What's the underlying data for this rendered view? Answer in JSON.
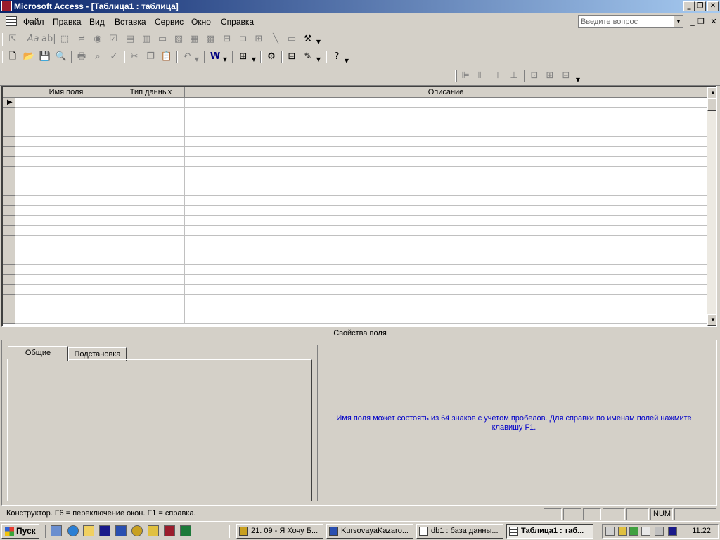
{
  "window": {
    "title": "Microsoft Access - [Таблица1 : таблица]",
    "controls": {
      "minimize": "_",
      "restore": "❐",
      "close": "✕"
    }
  },
  "menu": {
    "items": [
      {
        "label": "Файл"
      },
      {
        "label": "Правка"
      },
      {
        "label": "Вид"
      },
      {
        "label": "Вставка"
      },
      {
        "label": "Сервис"
      },
      {
        "label": "Окно"
      },
      {
        "label": "Справка"
      }
    ],
    "help_placeholder": "Введите вопрос",
    "mdi_controls": {
      "minimize": "_",
      "restore": "❐",
      "close": "✕"
    }
  },
  "toolbox": {
    "icons": [
      "pointer-icon",
      "label-aa-icon",
      "textbox-ab-icon",
      "option-group-icon",
      "toggle-button-icon",
      "option-button-icon",
      "checkbox-icon",
      "combo-box-icon",
      "list-box-icon",
      "command-button-icon",
      "image-icon",
      "unbound-frame-icon",
      "bound-frame-icon",
      "page-break-icon",
      "tab-control-icon",
      "subform-icon",
      "line-icon",
      "rectangle-icon",
      "more-controls-icon"
    ]
  },
  "design_toolbar": {
    "icons": [
      "view-icon",
      "new-icon",
      "open-icon",
      "save-icon",
      "search-icon",
      "print-icon",
      "print-preview-icon",
      "spelling-icon",
      "cut-icon",
      "copy-icon",
      "paste-icon",
      "undo-icon",
      "primary-key-icon",
      "indexes-icon",
      "insert-rows-icon",
      "delete-rows-icon",
      "properties-icon",
      "build-icon",
      "database-window-icon",
      "new-object-icon",
      "help-icon"
    ]
  },
  "align_toolbar": {
    "icons": [
      "align-left-icon",
      "align-right-icon",
      "align-top-icon",
      "align-bottom-icon",
      "size-to-fit-icon",
      "size-to-grid-icon",
      "spacing-icon"
    ]
  },
  "grid": {
    "columns": [
      {
        "label": "Имя поля"
      },
      {
        "label": "Тип данных"
      },
      {
        "label": "Описание"
      }
    ]
  },
  "properties": {
    "title": "Свойства поля",
    "tabs": [
      {
        "label": "Общие"
      },
      {
        "label": "Подстановка"
      }
    ],
    "description": "Имя поля может состоять из 64 знаков с учетом пробелов.  Для справки по именам полей нажмите клавишу F1."
  },
  "status": {
    "text": "Конструктор.  F6 = переключение окон.  F1 = справка.",
    "num": "NUM"
  },
  "taskbar": {
    "start_label": "Пуск",
    "quick_launch": [
      "show-desktop-icon",
      "ie-icon",
      "outlook-icon",
      "save-disk-icon",
      "word-icon",
      "media-icon",
      "pencil-icon",
      "access-icon",
      "excel-icon"
    ],
    "tasks": [
      {
        "label": "21. 09 - Я Хочу Б..."
      },
      {
        "label": "KursovayaKazaro..."
      },
      {
        "label": "db1 : база данны..."
      },
      {
        "label": "Таблица1 : таб..."
      }
    ],
    "tray_icons": [
      "volume-icon",
      "network-icon",
      "antivirus-icon",
      "update-icon",
      "safely-remove-icon",
      "disk-icon"
    ],
    "clock": "11:22"
  }
}
